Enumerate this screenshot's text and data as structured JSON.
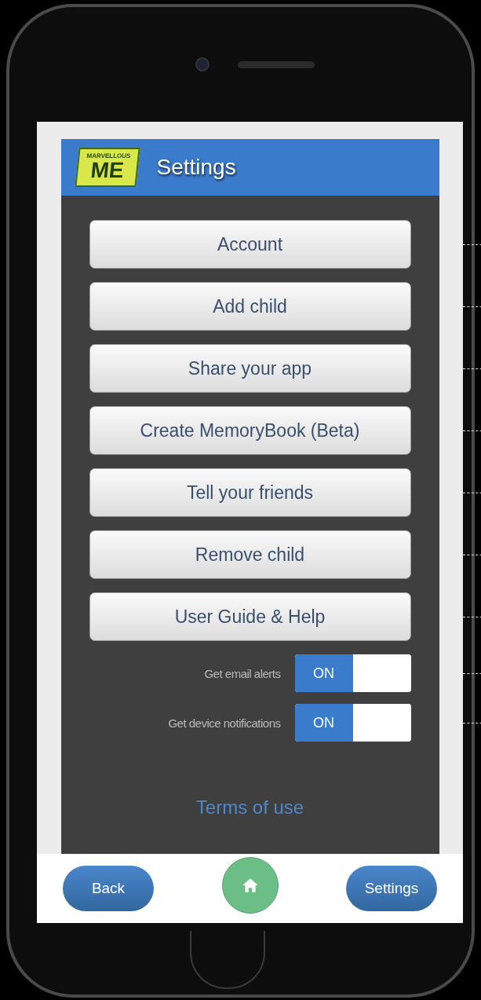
{
  "header": {
    "logo_top": "MARVELLOUS",
    "logo_main": "ME",
    "title": "Settings"
  },
  "menu_buttons": [
    "Account",
    "Add child",
    "Share your app",
    "Create MemoryBook (Beta)",
    "Tell your friends",
    "Remove child",
    "User Guide & Help"
  ],
  "toggles": [
    {
      "label": "Get email alerts",
      "state_label": "ON",
      "on": true
    },
    {
      "label": "Get device notifications",
      "state_label": "ON",
      "on": true
    }
  ],
  "terms_link": "Terms of use",
  "bottom_bar": {
    "back": "Back",
    "settings": "Settings"
  }
}
